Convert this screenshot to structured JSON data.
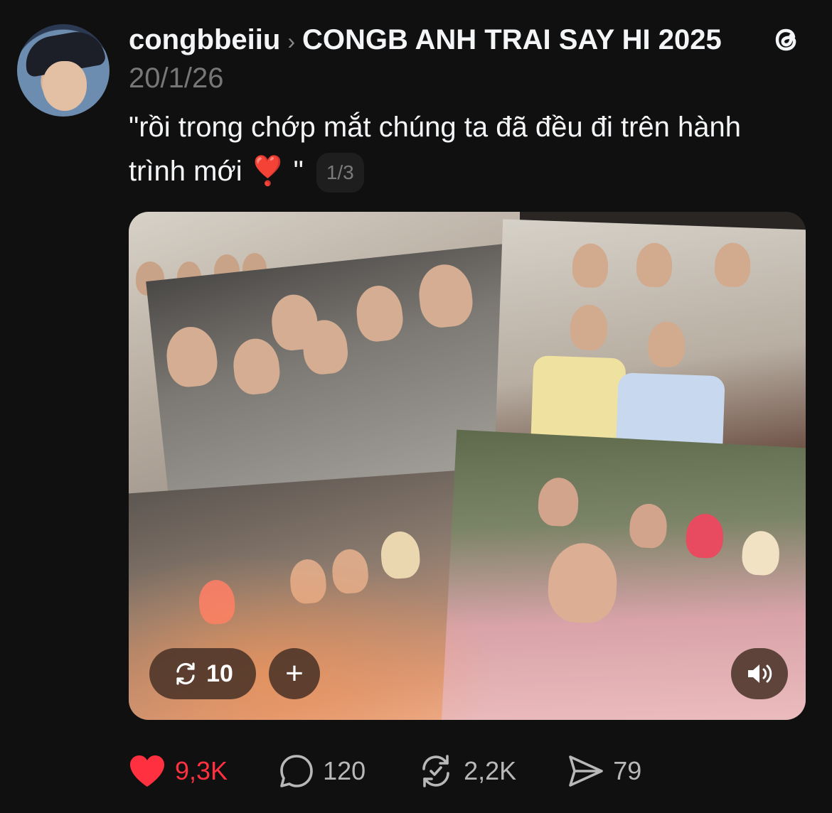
{
  "post": {
    "username": "congbbeiiu",
    "separator": "›",
    "community": "CONGB ANH TRAI SAY HI 2025",
    "date": "20/1/26",
    "caption": "\"rồi trong chớp mắt chúng ta đã đều đi trên hành trình mới ❣️ \"",
    "media_counter": "1/3"
  },
  "media_overlay": {
    "repost_count": "10",
    "plus_label": "+"
  },
  "actions": {
    "likes": "9,3K",
    "comments": "120",
    "reposts": "2,2K",
    "shares": "79"
  },
  "colors": {
    "background": "#101010",
    "text": "#f3f5f7",
    "muted": "#777777",
    "like": "#ff3040"
  },
  "icons": [
    "threads-logo-icon",
    "repost-icon",
    "plus-icon",
    "speaker-icon",
    "heart-icon",
    "comment-icon",
    "share-icon"
  ]
}
